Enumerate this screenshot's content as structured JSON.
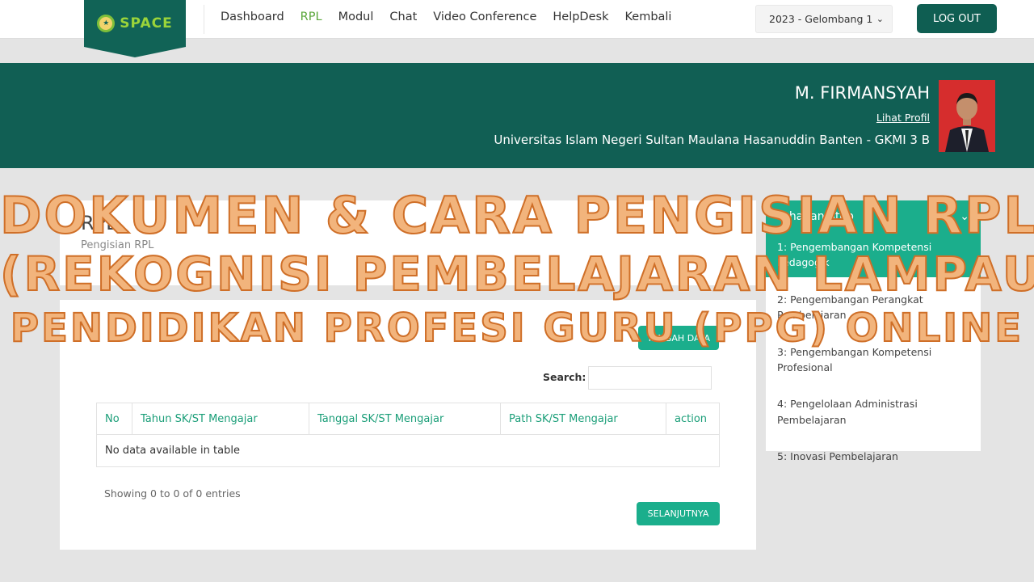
{
  "nav": {
    "logo_text": "SPACE",
    "items": [
      {
        "label": "Dashboard",
        "active": false
      },
      {
        "label": "RPL",
        "active": true
      },
      {
        "label": "Modul",
        "active": false
      },
      {
        "label": "Chat",
        "active": false
      },
      {
        "label": "Video Conference",
        "active": false
      },
      {
        "label": "HelpDesk",
        "active": false
      },
      {
        "label": "Kembali",
        "active": false
      }
    ],
    "period_selected": "2023 - Gelombang 1",
    "logout_label": "LOG OUT"
  },
  "profile": {
    "name": "M. FIRMANSYAH",
    "link_label": "Lihat Profil",
    "university": "Universitas Islam Negeri Sultan Maulana Hasanuddin Banten - GKMI 3 B"
  },
  "card": {
    "title": "RPL",
    "subtitle": "Pengisian RPL",
    "add_button": "TAMBAH DATA",
    "search_label": "Search:",
    "search_value": "",
    "table": {
      "headers": [
        "No",
        "Tahun SK/ST Mengajar",
        "Tanggal SK/ST Mengajar",
        "Path SK/ST Mengajar",
        "action"
      ],
      "empty_text": "No data available in table"
    },
    "showing": "Showing 0 to 0 of 0 entries",
    "next_button": "SELANJUTNYA"
  },
  "steps": {
    "header": "Tahapan Step",
    "items": [
      {
        "label": "1: Pengembangan Kompetensi Pedagogik",
        "active": true
      },
      {
        "label": "2: Pengembangan Perangkat Pembelajaran",
        "active": false
      },
      {
        "label": "3: Pengembangan Kompetensi Profesional",
        "active": false
      },
      {
        "label": "4: Pengelolaan Administrasi Pembelajaran",
        "active": false
      },
      {
        "label": "5: Inovasi Pembelajaran",
        "active": false
      }
    ]
  },
  "overlay": {
    "line1": "DOKUMEN & CARA PENGISIAN RPL",
    "line2": "(REKOGNISI PEMBELAJARAN LAMPAU)",
    "line3": "PENDIDIKAN PROFESI GURU (PPG) ONLINE"
  },
  "colors": {
    "brand_dark": "#115f54",
    "accent": "#1bae8c",
    "nav_active": "#5aa63a",
    "overlay_fill": "#f2b47c",
    "overlay_stroke": "#cf6f28"
  }
}
